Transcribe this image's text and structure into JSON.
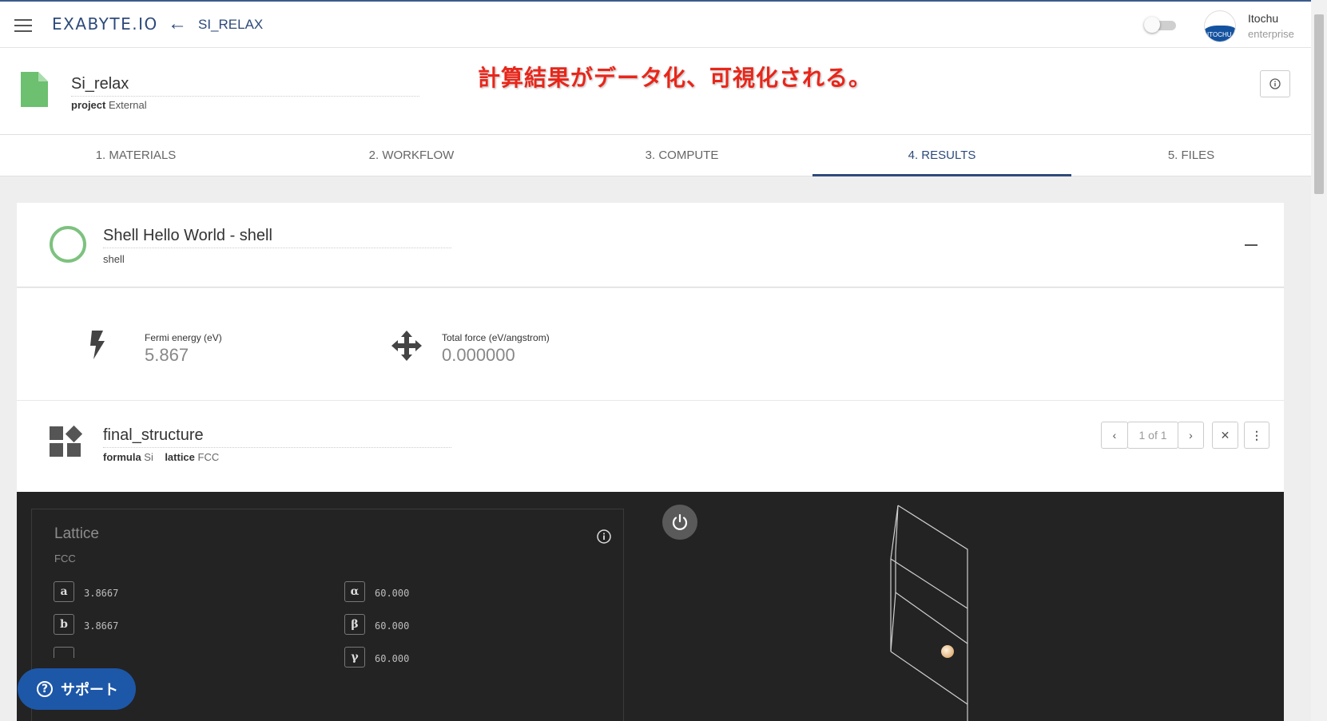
{
  "topbar": {
    "brand": "EXABYTE.IO",
    "breadcrumb": "SI_RELAX",
    "user_name": "Itochu",
    "user_plan": "enterprise",
    "avatar_text": "ITOCHU"
  },
  "header": {
    "title": "Si_relax",
    "meta_key": "project",
    "meta_value": "External",
    "annotation": "計算結果がデータ化、可視化される。"
  },
  "tabs": [
    "1. MATERIALS",
    "2. WORKFLOW",
    "3. COMPUTE",
    "4. RESULTS",
    "5. FILES"
  ],
  "active_tab": "4. RESULTS",
  "unit": {
    "title": "Shell Hello World - shell",
    "subtitle": "shell"
  },
  "properties": {
    "fermi_label": "Fermi energy (eV)",
    "fermi_value": "5.867",
    "force_label": "Total force (eV/angstrom)",
    "force_value": "0.000000"
  },
  "structure": {
    "title": "final_structure",
    "formula_key": "formula",
    "formula_value": "Si",
    "lattice_key": "lattice",
    "lattice_value": "FCC",
    "pager_text": "1 of 1"
  },
  "lattice": {
    "title": "Lattice",
    "type": "FCC",
    "params": [
      {
        "symbol": "a",
        "value": "3.8667"
      },
      {
        "symbol": "b",
        "value": "3.8667"
      },
      {
        "symbol": "α",
        "value": "60.000"
      },
      {
        "symbol": "β",
        "value": "60.000"
      },
      {
        "symbol": "γ",
        "value": "60.000"
      }
    ]
  },
  "support": {
    "label": "サポート"
  },
  "colors": {
    "brand": "#2d4a7a",
    "annotation": "#e8261a",
    "status_ring": "#7dc27f",
    "file_icon": "#6cc070",
    "viewer_bg": "#232323",
    "support_bg": "#1d57a8"
  }
}
